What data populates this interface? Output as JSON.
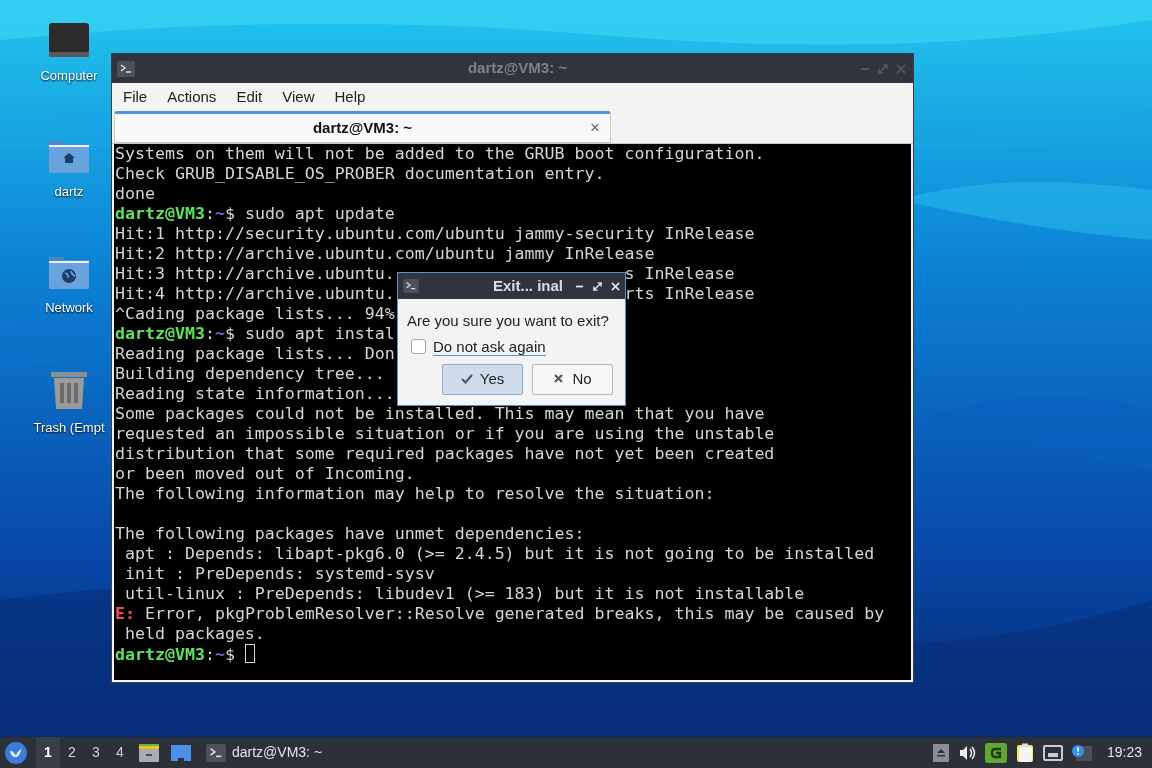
{
  "desktop_icons": [
    {
      "kind": "computer",
      "label": "Computer"
    },
    {
      "kind": "home",
      "label": "dartz"
    },
    {
      "kind": "network",
      "label": "Network"
    },
    {
      "kind": "trash",
      "label": "Trash (Empt"
    }
  ],
  "terminal_window": {
    "title": "dartz@VM3: ~",
    "menu": [
      "File",
      "Actions",
      "Edit",
      "View",
      "Help"
    ],
    "tabs": [
      {
        "label": "dartz@VM3: ~",
        "selected": true,
        "close": "×"
      }
    ],
    "lines": [
      {
        "kind": "output",
        "segments": [
          {
            "kind": "text",
            "text": "Systems on them will not be added to the GRUB boot configuration."
          }
        ]
      },
      {
        "kind": "output",
        "segments": [
          {
            "kind": "text",
            "text": "Check GRUB_DISABLE_OS_PROBER documentation entry."
          }
        ]
      },
      {
        "kind": "output",
        "segments": [
          {
            "kind": "text",
            "text": "done"
          }
        ]
      },
      {
        "kind": "output",
        "segments": [
          {
            "kind": "user",
            "text": "dartz@VM3"
          },
          {
            "kind": "text",
            "text": ":"
          },
          {
            "kind": "path",
            "text": "~"
          },
          {
            "kind": "text",
            "text": "$ sudo apt update"
          }
        ]
      },
      {
        "kind": "output",
        "segments": [
          {
            "kind": "text",
            "text": "Hit:1 http://security.ubuntu.com/ubuntu jammy-security InRelease"
          }
        ]
      },
      {
        "kind": "output",
        "segments": [
          {
            "kind": "text",
            "text": "Hit:2 http://archive.ubuntu.com/ubuntu jammy InRelease"
          }
        ]
      },
      {
        "kind": "output",
        "segments": [
          {
            "kind": "text",
            "text": "Hit:3 http://archive.ubuntu."
          }
        ],
        "tail": {
          "text": "s InRelease"
        }
      },
      {
        "kind": "output",
        "segments": [
          {
            "kind": "text",
            "text": "Hit:4 http://archive.ubuntu."
          }
        ],
        "tail": {
          "text": "rts InRelease"
        }
      },
      {
        "kind": "output",
        "segments": [
          {
            "kind": "text",
            "text": "^Cading package lists... 94%"
          }
        ]
      },
      {
        "kind": "output",
        "segments": [
          {
            "kind": "user",
            "text": "dartz@VM3"
          },
          {
            "kind": "text",
            "text": ":"
          },
          {
            "kind": "path",
            "text": "~"
          },
          {
            "kind": "text",
            "text": "$ sudo apt instal"
          }
        ]
      },
      {
        "kind": "output",
        "segments": [
          {
            "kind": "text",
            "text": "Reading package lists... Don"
          }
        ]
      },
      {
        "kind": "output",
        "segments": [
          {
            "kind": "text",
            "text": "Building dependency tree..."
          }
        ]
      },
      {
        "kind": "output",
        "segments": [
          {
            "kind": "text",
            "text": "Reading state information..."
          }
        ]
      },
      {
        "kind": "output",
        "segments": [
          {
            "kind": "text",
            "text": "Some packages could not be installed. This may mean that you have"
          }
        ]
      },
      {
        "kind": "output",
        "segments": [
          {
            "kind": "text",
            "text": "requested an impossible situation or if you are using the unstable"
          }
        ]
      },
      {
        "kind": "output",
        "segments": [
          {
            "kind": "text",
            "text": "distribution that some required packages have not yet been created"
          }
        ]
      },
      {
        "kind": "output",
        "segments": [
          {
            "kind": "text",
            "text": "or been moved out of Incoming."
          }
        ]
      },
      {
        "kind": "output",
        "segments": [
          {
            "kind": "text",
            "text": "The following information may help to resolve the situation:"
          }
        ]
      },
      {
        "kind": "blank"
      },
      {
        "kind": "output",
        "segments": [
          {
            "kind": "text",
            "text": "The following packages have unmet dependencies:"
          }
        ]
      },
      {
        "kind": "output",
        "segments": [
          {
            "kind": "text",
            "text": " apt : Depends: libapt-pkg6.0 (>= 2.4.5) but it is not going to be installed"
          }
        ]
      },
      {
        "kind": "output",
        "segments": [
          {
            "kind": "text",
            "text": " init : PreDepends: systemd-sysv"
          }
        ]
      },
      {
        "kind": "output",
        "segments": [
          {
            "kind": "text",
            "text": " util-linux : PreDepends: libudev1 (>= 183) but it is not installable"
          }
        ]
      },
      {
        "kind": "output",
        "segments": [
          {
            "kind": "error",
            "text": "E:"
          },
          {
            "kind": "text",
            "text": " Error, pkgProblemResolver::Resolve generated breaks, this may be caused by"
          }
        ]
      },
      {
        "kind": "output",
        "segments": [
          {
            "kind": "text",
            "text": " held packages."
          }
        ]
      },
      {
        "kind": "output",
        "segments": [
          {
            "kind": "user",
            "text": "dartz@VM3"
          },
          {
            "kind": "text",
            "text": ":"
          },
          {
            "kind": "path",
            "text": "~"
          },
          {
            "kind": "text",
            "text": "$ "
          }
        ],
        "cursor": true
      }
    ]
  },
  "dialog": {
    "title": "Exit... inal",
    "message": "Are you sure you want to exit?",
    "checkbox": {
      "label": "Do not ask again",
      "checked": false
    },
    "buttons": [
      {
        "kind": "yes",
        "label": "Yes",
        "selected": true
      },
      {
        "kind": "no",
        "label": "No",
        "selected": false
      }
    ]
  },
  "taskbar": {
    "workspaces": [
      {
        "label": "1",
        "selected": true
      },
      {
        "label": "2",
        "selected": false
      },
      {
        "label": "3",
        "selected": false
      },
      {
        "label": "4",
        "selected": false
      }
    ],
    "tasks": [
      {
        "label": "dartz@VM3: ~"
      }
    ],
    "clock": "19:23"
  }
}
